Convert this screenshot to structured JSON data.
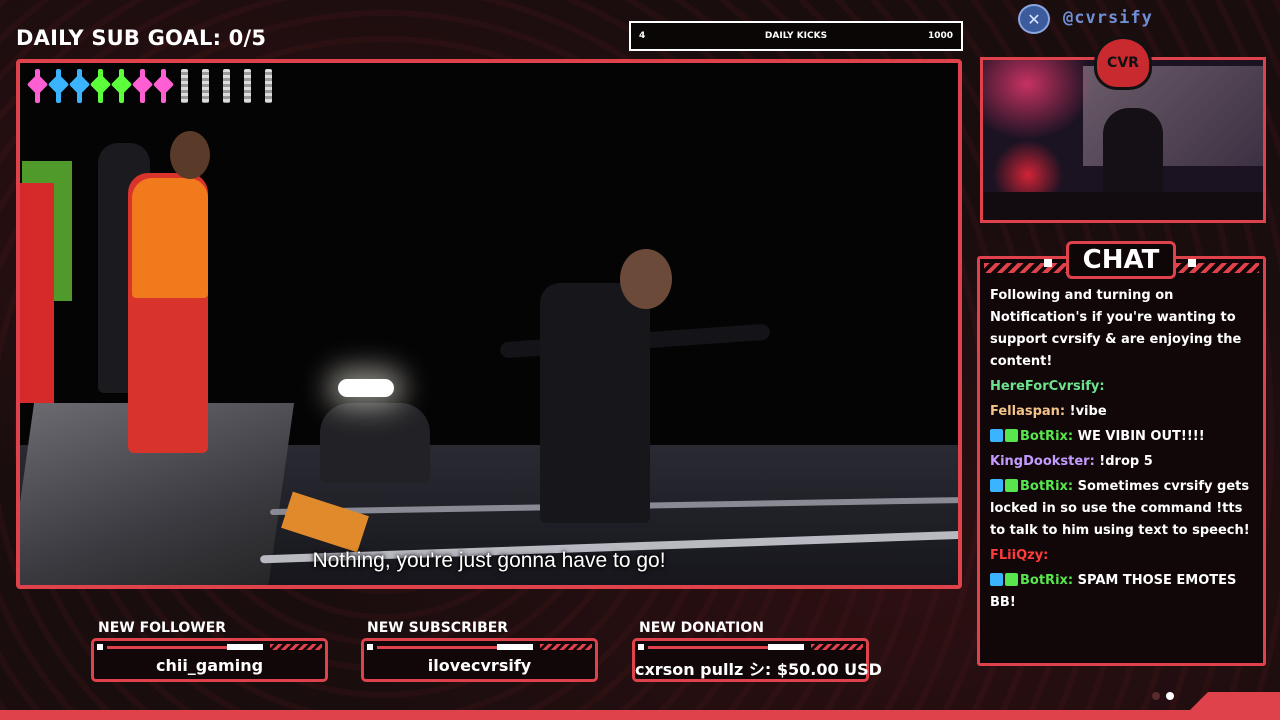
{
  "overlay": {
    "sub_goal": "DAILY SUB GOAL: 0/5",
    "kicks_bar": {
      "left": "4",
      "title": "DAILY KICKS",
      "right": "1000"
    },
    "handle": "@cvrsify",
    "logo_text": "CVR"
  },
  "video": {
    "subtitle": "Nothing, you're just gonna have to go!",
    "gems_filled_colors": [
      "#ff5fd2",
      "#3ab4ff",
      "#3ab4ff",
      "#5bff3a",
      "#5bff3a",
      "#ff5fd2",
      "#ff5fd2"
    ],
    "gems_empty_count": 5
  },
  "chat": {
    "title": "CHAT",
    "messages": [
      {
        "user": "",
        "color": "#ffffff",
        "text": "Following and turning on Notification's if you're wanting to support cvrsify & are enjoying the content!"
      },
      {
        "user": "HereForCvrsify:",
        "color": "#6de38f",
        "text": ""
      },
      {
        "user": "Fellaspan:",
        "color": "#f2c48a",
        "text": "!vibe"
      },
      {
        "user": "BotRix:",
        "color": "#57e64d",
        "text": "WE VIBIN OUT!!!!"
      },
      {
        "user": "KingDookster:",
        "color": "#c39bff",
        "text": "!drop 5"
      },
      {
        "user": "BotRix:",
        "color": "#57e64d",
        "text": "Sometimes cvrsify gets locked in so use the command !tts to talk to him using text to speech!"
      },
      {
        "user": "FLiiQzy:",
        "color": "#ff3b3b",
        "text": ""
      },
      {
        "user": "BotRix:",
        "color": "#57e64d",
        "text": "SPAM THOSE EMOTES BB!"
      }
    ]
  },
  "alerts": {
    "follower": {
      "label": "NEW FOLLOWER",
      "value": "chii_gaming"
    },
    "subscriber": {
      "label": "NEW SUBSCRIBER",
      "value": "ilovecvrsify"
    },
    "donation": {
      "label": "NEW DONATION",
      "value": "cxrson pullz シ: $50.00 USD"
    }
  },
  "colors": {
    "accent": "#e0424c",
    "background": "#1a0d0e"
  }
}
